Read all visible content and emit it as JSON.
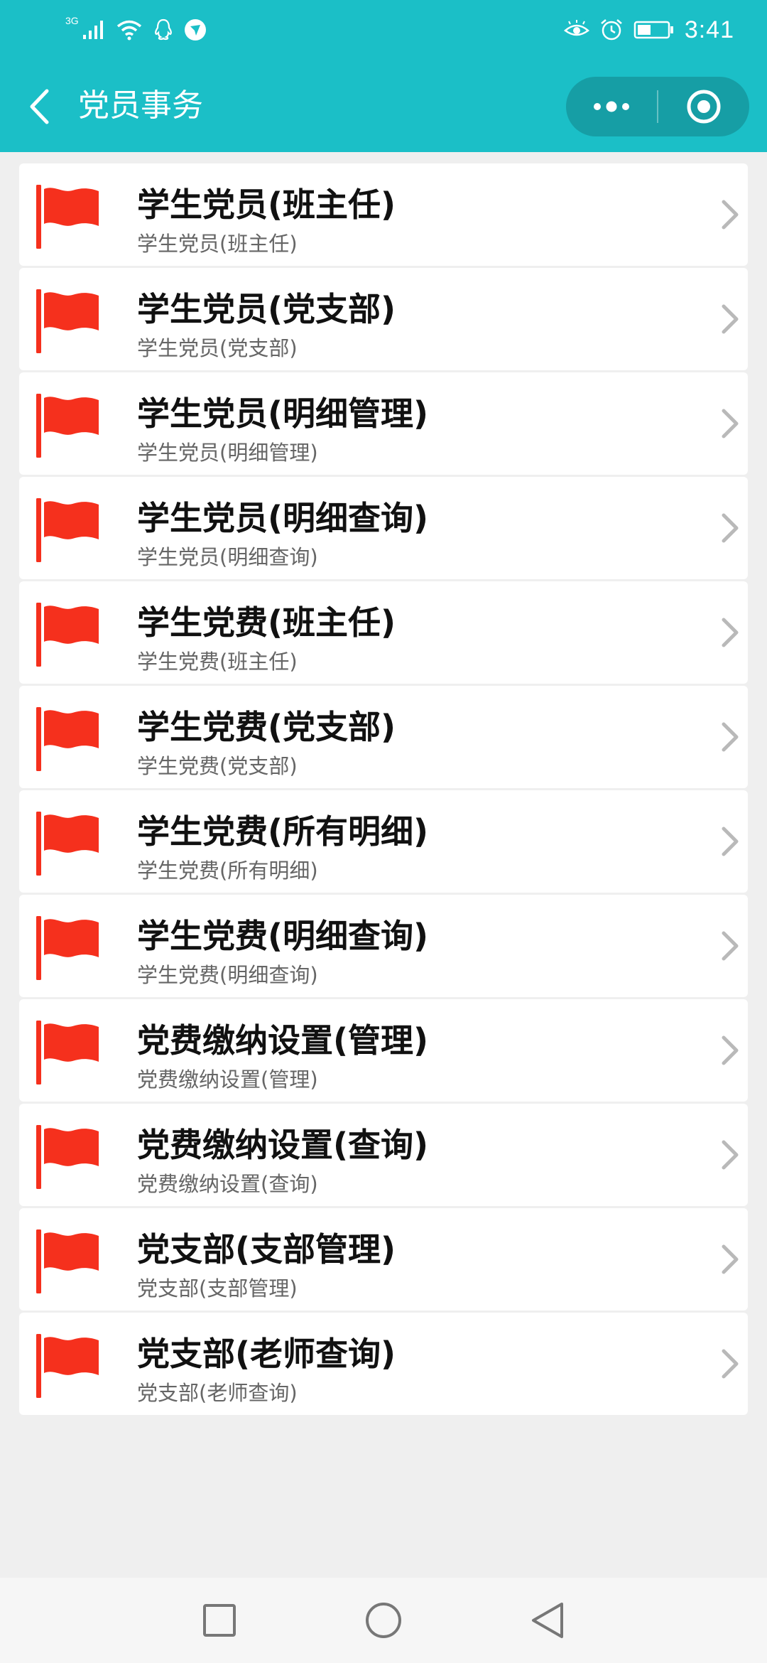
{
  "status_bar": {
    "network_type": "3G",
    "time": "3:41",
    "left_icons": [
      "signal-icon",
      "wifi-icon",
      "qq-icon",
      "app-notification-icon"
    ],
    "right_icons": [
      "eye-icon",
      "alarm-icon",
      "battery-icon"
    ]
  },
  "nav": {
    "title": "党员事务",
    "back_icon": "chevron-left-icon",
    "menu_icon": "more-dots-icon",
    "close_icon": "target-close-icon",
    "bar_color": "#1bbfc7"
  },
  "list": {
    "icon": "red-flag-icon",
    "flag_color": "#f5301d",
    "items": [
      {
        "title": "学生党员(班主任)",
        "subtitle": "学生党员(班主任)"
      },
      {
        "title": "学生党员(党支部)",
        "subtitle": "学生党员(党支部)"
      },
      {
        "title": "学生党员(明细管理)",
        "subtitle": "学生党员(明细管理)"
      },
      {
        "title": "学生党员(明细查询)",
        "subtitle": "学生党员(明细查询)"
      },
      {
        "title": "学生党费(班主任)",
        "subtitle": "学生党费(班主任)"
      },
      {
        "title": "学生党费(党支部)",
        "subtitle": "学生党费(党支部)"
      },
      {
        "title": "学生党费(所有明细)",
        "subtitle": "学生党费(所有明细)"
      },
      {
        "title": "学生党费(明细查询)",
        "subtitle": "学生党费(明细查询)"
      },
      {
        "title": "党费缴纳设置(管理)",
        "subtitle": "党费缴纳设置(管理)"
      },
      {
        "title": "党费缴纳设置(查询)",
        "subtitle": "党费缴纳设置(查询)"
      },
      {
        "title": "党支部(支部管理)",
        "subtitle": "党支部(支部管理)"
      },
      {
        "title": "党支部(老师查询)",
        "subtitle": "党支部(老师查询)"
      }
    ]
  },
  "system_nav": [
    "recent-apps-icon",
    "home-icon",
    "back-triangle-icon"
  ]
}
